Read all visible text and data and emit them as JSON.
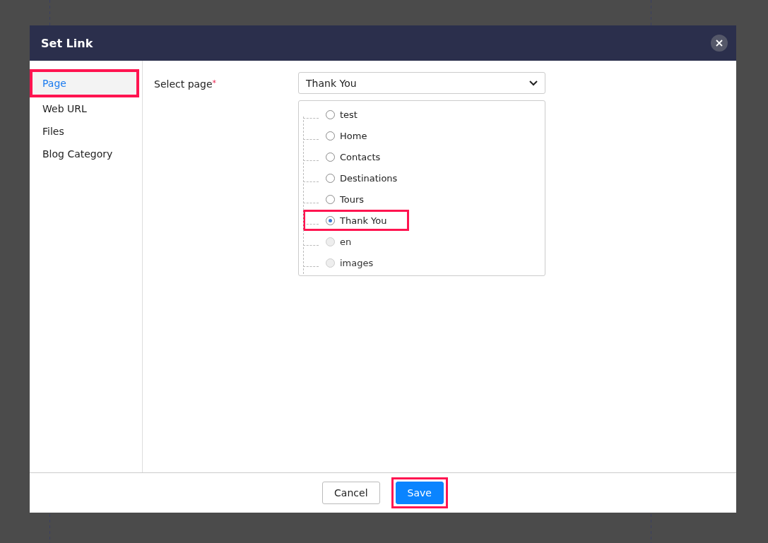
{
  "dialog": {
    "title": "Set Link"
  },
  "sidebar": {
    "items": [
      {
        "label": "Page",
        "selected": true,
        "highlighted": true
      },
      {
        "label": "Web URL",
        "selected": false,
        "highlighted": false
      },
      {
        "label": "Files",
        "selected": false,
        "highlighted": false
      },
      {
        "label": "Blog Category",
        "selected": false,
        "highlighted": false
      }
    ]
  },
  "form": {
    "label": "Select page",
    "required_mark": "*",
    "dropdown": {
      "value": "Thank You"
    },
    "pages": [
      {
        "label": "test",
        "selected": false,
        "disabled": false,
        "highlighted": false
      },
      {
        "label": "Home",
        "selected": false,
        "disabled": false,
        "highlighted": false
      },
      {
        "label": "Contacts",
        "selected": false,
        "disabled": false,
        "highlighted": false
      },
      {
        "label": "Destinations",
        "selected": false,
        "disabled": false,
        "highlighted": false
      },
      {
        "label": "Tours",
        "selected": false,
        "disabled": false,
        "highlighted": false
      },
      {
        "label": "Thank You",
        "selected": true,
        "disabled": false,
        "highlighted": true
      },
      {
        "label": "en",
        "selected": false,
        "disabled": true,
        "highlighted": false
      },
      {
        "label": "images",
        "selected": false,
        "disabled": true,
        "highlighted": false
      }
    ]
  },
  "buttons": [
    {
      "label": "Cancel",
      "kind": "secondary",
      "highlighted": false
    },
    {
      "label": "Save",
      "kind": "primary",
      "highlighted": true
    }
  ]
}
